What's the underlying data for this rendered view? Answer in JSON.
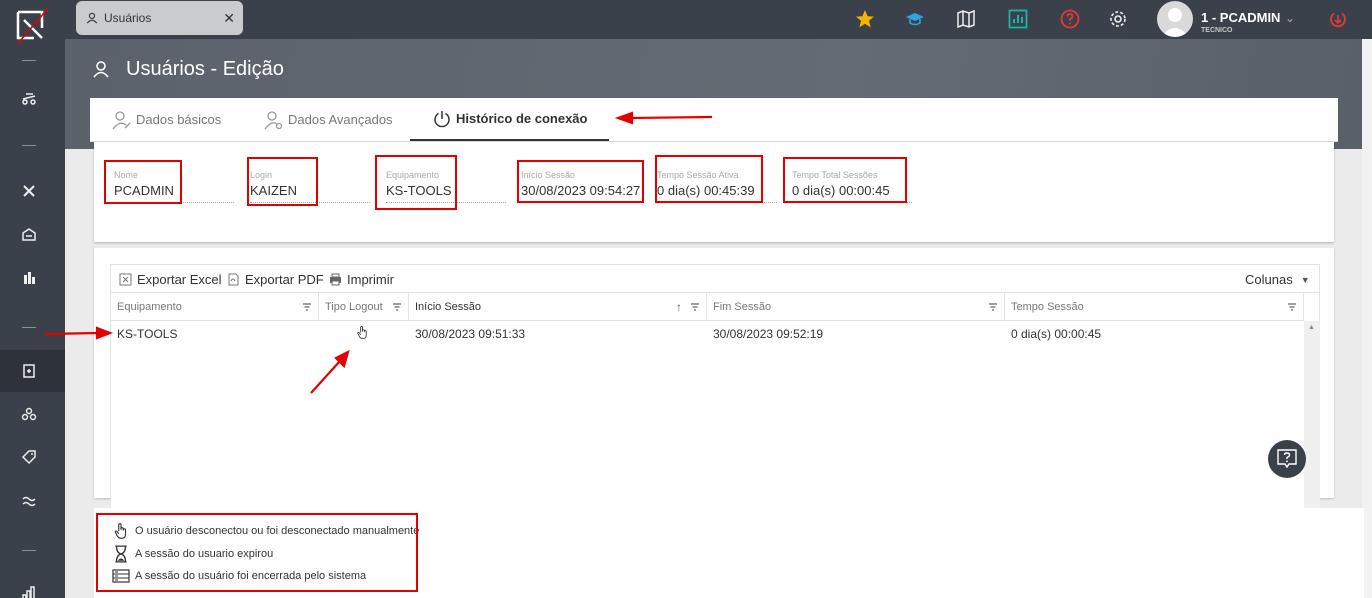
{
  "top_tab": {
    "label": "Usuários",
    "close": "✕"
  },
  "user": {
    "name": "1 - PCADMIN",
    "role": "TECNICO"
  },
  "page": {
    "title": "Usuários - Edição"
  },
  "tabs": [
    {
      "label": "Dados básicos"
    },
    {
      "label": "Dados Avançados"
    },
    {
      "label": "Histórico de conexão"
    }
  ],
  "fields": {
    "nome": {
      "label": "Nome",
      "value": "PCADMIN"
    },
    "login": {
      "label": "Login",
      "value": "KAIZEN"
    },
    "equipamento": {
      "label": "Equipamento",
      "value": "KS-TOOLS"
    },
    "inicio": {
      "label": "Início Sessão",
      "value": "30/08/2023 09:54:27"
    },
    "tempo_ativa": {
      "label": "Tempo Sessão Ativa",
      "value": "0 dia(s) 00:45:39"
    },
    "tempo_total": {
      "label": "Tempo Total Sessões",
      "value": "0 dia(s) 00:00:45"
    }
  },
  "toolbar": {
    "excel": "Exportar Excel",
    "pdf": "Exportar PDF",
    "print": "Imprimir",
    "columns": "Colunas"
  },
  "columns": [
    "Equipamento",
    "Tipo Logout",
    "Início Sessão",
    "Fim Sessão",
    "Tempo Sessão"
  ],
  "rows": [
    {
      "equipamento": "KS-TOOLS",
      "inicio": "30/08/2023 09:51:33",
      "fim": "30/08/2023 09:52:19",
      "tempo": "0 dia(s) 00:00:45"
    }
  ],
  "legend": [
    {
      "text": "O usuário desconectou ou foi desconectado manualmente"
    },
    {
      "text": "A sessão do usuario expirou"
    },
    {
      "text": "A sessão do usuário foi encerrada pelo sistema"
    }
  ],
  "colors": {
    "sidebar": "#3b414b",
    "annotation": "#e30000",
    "star": "#f5b400",
    "teal": "#1fb3a6",
    "blue": "#2aa7e0",
    "red": "#e53935"
  },
  "icons": [
    "logo-icon",
    "star-icon",
    "graduation-cap-icon",
    "map-icon",
    "chart-icon",
    "help-icon",
    "gear-icon",
    "logout-icon"
  ]
}
